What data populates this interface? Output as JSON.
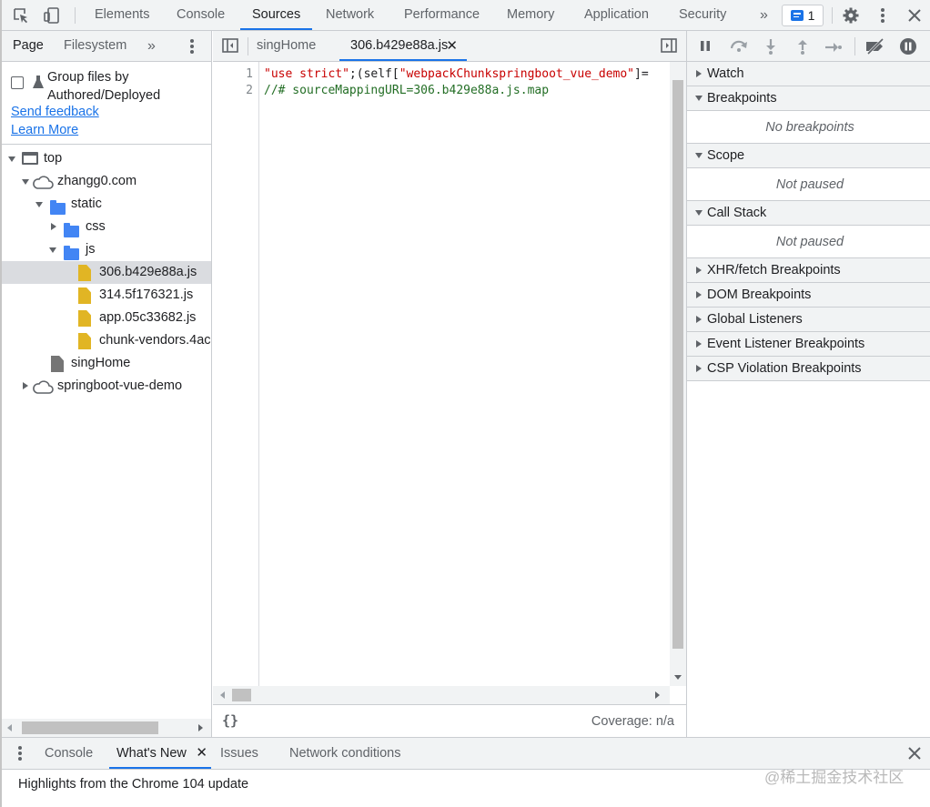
{
  "toolbar": {
    "tabs": [
      "Elements",
      "Console",
      "Sources",
      "Network",
      "Performance",
      "Memory",
      "Application",
      "Security"
    ],
    "active_tab": "Sources",
    "more": "»",
    "message_count": "1"
  },
  "navigator": {
    "tabs": [
      "Page",
      "Filesystem"
    ],
    "more": "»",
    "group_label": "Group files by Authored/Deployed",
    "group_line1": "Group files by",
    "group_line2": "Authored/Deployed",
    "send_feedback": "Send feedback",
    "learn_more": "Learn More",
    "tree": {
      "top": "top",
      "domain": "zhangg0.com",
      "static": "static",
      "css": "css",
      "js": "js",
      "files": [
        "306.b429e88a.js",
        "314.5f176321.js",
        "app.05c33682.js",
        "chunk-vendors.4ac"
      ],
      "singHome": "singHome",
      "springboot": "springboot-vue-demo"
    }
  },
  "editor": {
    "tabs": [
      "singHome",
      "306.b429e88a.js"
    ],
    "lines": [
      {
        "n": "1",
        "parts": [
          {
            "t": "\"use strict\"",
            "c": "str"
          },
          {
            "t": ";(self[",
            "c": ""
          },
          {
            "t": "\"webpackChunkspringboot_vue_demo\"",
            "c": "str"
          },
          {
            "t": "]=",
            "c": ""
          }
        ]
      },
      {
        "n": "2",
        "parts": [
          {
            "t": "//# sourceMappingURL=306.b429e88a.js.map",
            "c": "cmt"
          }
        ]
      }
    ],
    "pretty_print": "{}",
    "coverage": "Coverage: n/a"
  },
  "debugger": {
    "watch": "Watch",
    "breakpoints": "Breakpoints",
    "no_breakpoints": "No breakpoints",
    "scope": "Scope",
    "not_paused_scope": "Not paused",
    "call_stack": "Call Stack",
    "not_paused_stack": "Not paused",
    "xhr": "XHR/fetch Breakpoints",
    "dom": "DOM Breakpoints",
    "global": "Global Listeners",
    "event": "Event Listener Breakpoints",
    "csp": "CSP Violation Breakpoints"
  },
  "drawer": {
    "tabs": [
      "Console",
      "What's New",
      "Issues",
      "Network conditions"
    ],
    "active_tab": "What's New",
    "highlight": "Highlights from the Chrome 104 update"
  },
  "watermark": "@稀土掘金技术社区",
  "colors": {
    "accent": "#1a73e8",
    "toolbar_bg": "#f1f3f4",
    "string": "#c80000",
    "comment": "#236e25",
    "js_file": "#e1b524",
    "folder": "#4285f4"
  }
}
